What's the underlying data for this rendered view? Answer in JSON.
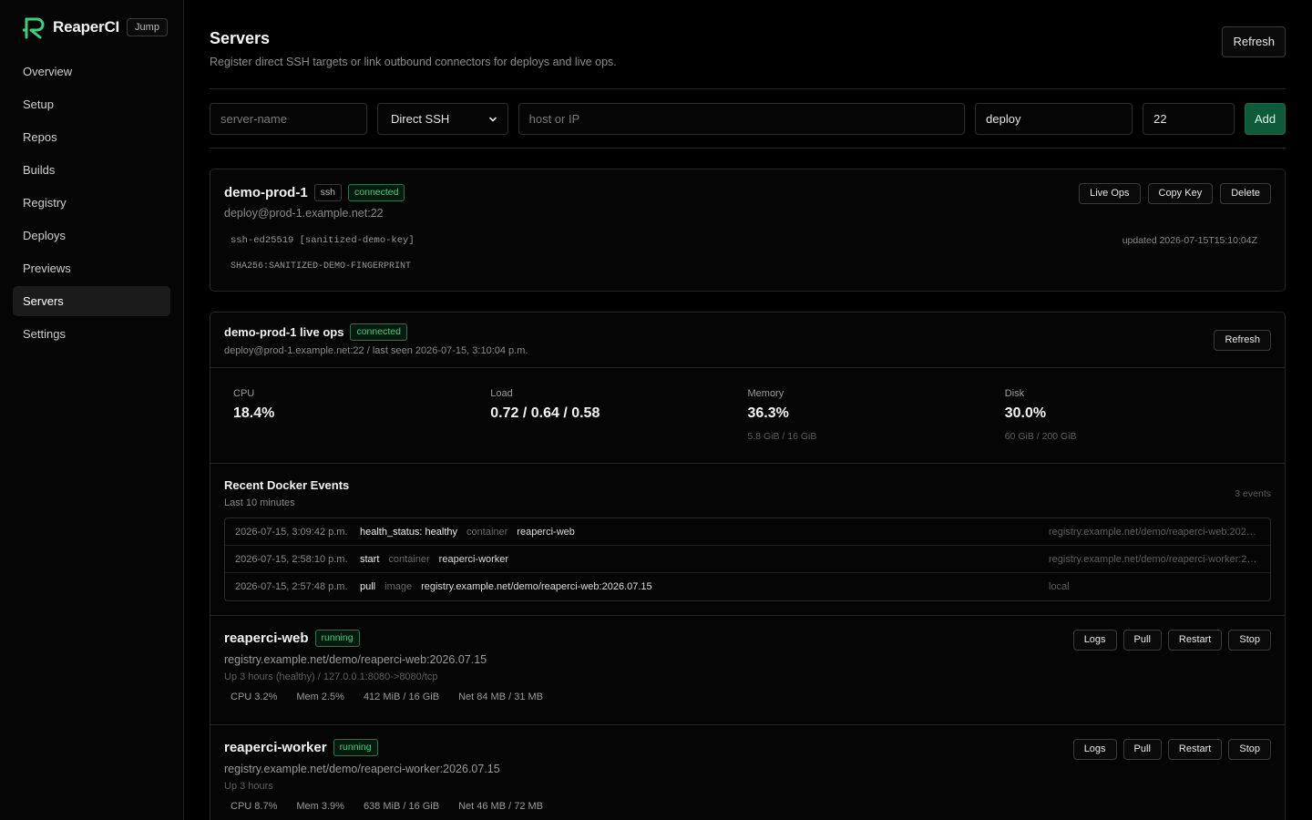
{
  "brand": {
    "name": "ReaperCI",
    "jump_label": "Jump",
    "accent": "#3ecf7e"
  },
  "nav": [
    "Overview",
    "Setup",
    "Repos",
    "Builds",
    "Registry",
    "Deploys",
    "Previews",
    "Servers",
    "Settings"
  ],
  "page": {
    "title": "Servers",
    "subtitle": "Register direct SSH targets or link outbound connectors for deploys and live ops.",
    "refresh_label": "Refresh"
  },
  "form": {
    "name_placeholder": "server-name",
    "type_value": "Direct SSH",
    "host_placeholder": "host or IP",
    "user_value": "deploy",
    "port_value": "22",
    "add_label": "Add"
  },
  "server": {
    "name": "demo-prod-1",
    "type_tag": "ssh",
    "status": "connected",
    "address": "deploy@prod-1.example.net:22",
    "key": "ssh-ed25519 [sanitized-demo-key]",
    "fingerprint": "SHA256:SANITIZED-DEMO-FINGERPRINT",
    "updated": "updated 2026-07-15T15:10:04Z",
    "actions": {
      "live_ops": "Live Ops",
      "copy_key": "Copy Key",
      "delete": "Delete"
    }
  },
  "live_ops": {
    "title": "demo-prod-1 live ops",
    "status": "connected",
    "meta": "deploy@prod-1.example.net:22 / last seen 2026-07-15, 3:10:04 p.m.",
    "refresh_label": "Refresh",
    "metrics": {
      "cpu": {
        "label": "CPU",
        "value": "18.4%",
        "sub": ""
      },
      "load": {
        "label": "Load",
        "value": "0.72 / 0.64 / 0.58",
        "sub": ""
      },
      "memory": {
        "label": "Memory",
        "value": "36.3%",
        "sub": "5.8 GiB / 16 GiB"
      },
      "disk": {
        "label": "Disk",
        "value": "30.0%",
        "sub": "60 GiB / 200 GiB"
      }
    },
    "events": {
      "title": "Recent Docker Events",
      "subtitle": "Last 10 minutes",
      "count": "3 events",
      "rows": [
        {
          "time": "2026-07-15, 3:09:42 p.m.",
          "action": "health_status: healthy",
          "kind": "container",
          "target": "reaperci-web",
          "image": "registry.example.net/demo/reaperci-web:2026...."
        },
        {
          "time": "2026-07-15, 2:58:10 p.m.",
          "action": "start",
          "kind": "container",
          "target": "reaperci-worker",
          "image": "registry.example.net/demo/reaperci-worker:20..."
        },
        {
          "time": "2026-07-15, 2:57:48 p.m.",
          "action": "pull",
          "kind": "image",
          "target": "registry.example.net/demo/reaperci-web:2026.07.15",
          "image": "local"
        }
      ]
    },
    "containers": [
      {
        "name": "reaperci-web",
        "status": "running",
        "image": "registry.example.net/demo/reaperci-web:2026.07.15",
        "uptime": "Up 3 hours (healthy) / 127.0.0.1:8080->8080/tcp",
        "cpu": "CPU 3.2%",
        "mem": "Mem 2.5%",
        "mem_abs": "412 MiB / 16 GiB",
        "net": "Net 84 MB / 31 MB"
      },
      {
        "name": "reaperci-worker",
        "status": "running",
        "image": "registry.example.net/demo/reaperci-worker:2026.07.15",
        "uptime": "Up 3 hours",
        "cpu": "CPU 8.7%",
        "mem": "Mem 3.9%",
        "mem_abs": "638 MiB / 16 GiB",
        "net": "Net 46 MB / 72 MB"
      }
    ],
    "container_actions": {
      "logs": "Logs",
      "pull": "Pull",
      "restart": "Restart",
      "stop": "Stop"
    }
  }
}
